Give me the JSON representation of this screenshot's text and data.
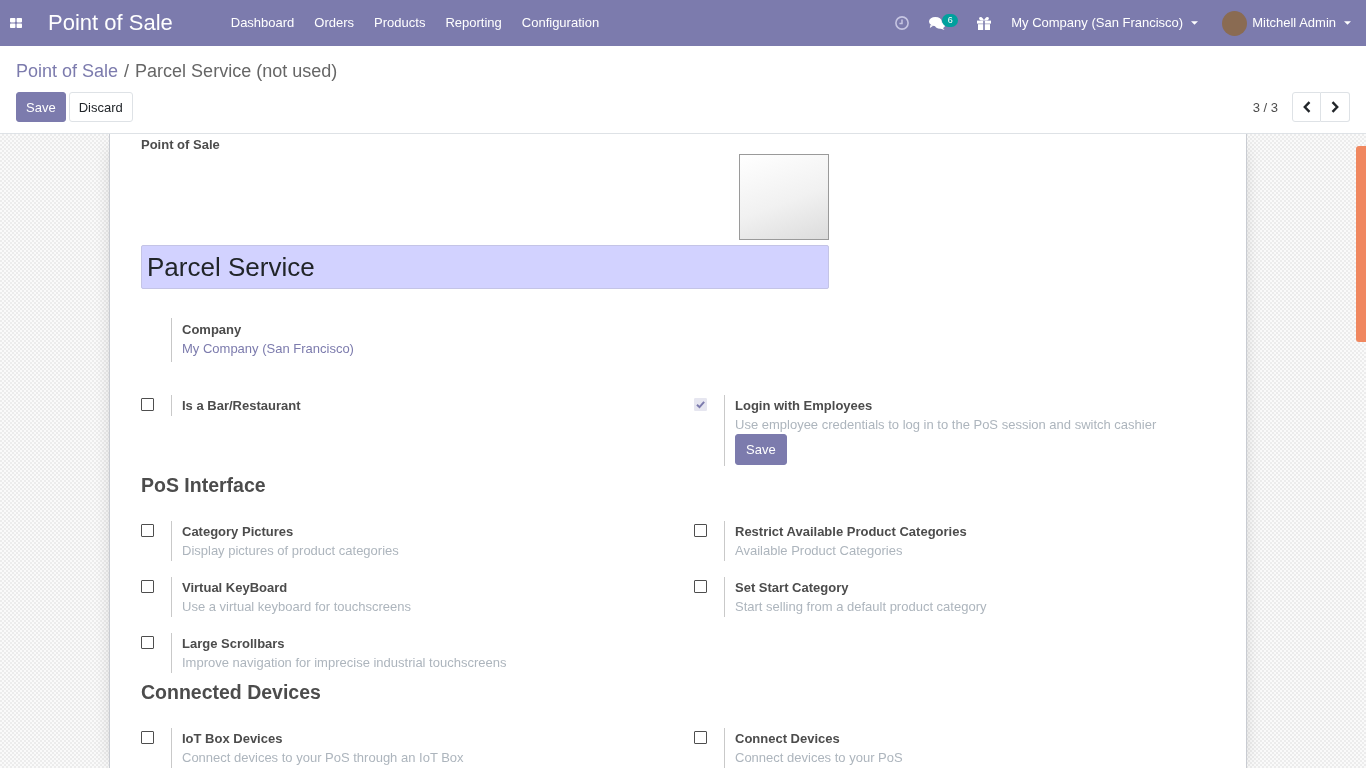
{
  "navbar": {
    "app_title": "Point of Sale",
    "menu": [
      "Dashboard",
      "Orders",
      "Products",
      "Reporting",
      "Configuration"
    ],
    "messages_badge": "6",
    "company": "My Company (San Francisco)",
    "user": "Mitchell Admin"
  },
  "breadcrumb": {
    "items": [
      {
        "label": "Point of Sale",
        "kind": "link"
      },
      {
        "label": "Parcel Service (not used)",
        "kind": "current"
      }
    ],
    "separator": "/"
  },
  "buttons": [
    {
      "label": "Save",
      "kind": "primary"
    },
    {
      "label": "Discard",
      "kind": "secondary"
    }
  ],
  "pager": {
    "value": "3 / 3"
  },
  "form": {
    "label": "Point of Sale",
    "name": "Parcel Service",
    "company": {
      "label": "Company",
      "value": "My Company (San Francisco)"
    },
    "sections": [
      {
        "settings": [
          {
            "label": "Is a Bar/Restaurant",
            "checked": false,
            "disabled": false
          },
          {
            "label": "Login with Employees",
            "description": "Use employee credentials to log in to the PoS session and switch cashier",
            "checked": true,
            "disabled": true,
            "button": "Save"
          }
        ]
      },
      {
        "heading": "PoS Interface",
        "settings": [
          {
            "label": "Category Pictures",
            "description": "Display pictures of product categories",
            "checked": false,
            "disabled": false
          },
          {
            "label": "Restrict Available Product Categories",
            "description": "Available Product Categories",
            "checked": false,
            "disabled": false
          },
          {
            "label": "Virtual KeyBoard",
            "description": "Use a virtual keyboard for touchscreens",
            "checked": false,
            "disabled": false
          },
          {
            "label": "Set Start Category",
            "description": "Start selling from a default product category",
            "checked": false,
            "disabled": false
          },
          {
            "label": "Large Scrollbars",
            "description": "Improve navigation for imprecise industrial touchscreens",
            "checked": false,
            "disabled": false
          }
        ]
      },
      {
        "heading": "Connected Devices",
        "settings": [
          {
            "label": "IoT Box Devices",
            "description": "Connect devices to your PoS through an IoT Box",
            "checked": false,
            "disabled": false
          },
          {
            "label": "Connect Devices",
            "description": "Connect devices to your PoS",
            "checked": false,
            "disabled": false
          }
        ]
      }
    ]
  }
}
